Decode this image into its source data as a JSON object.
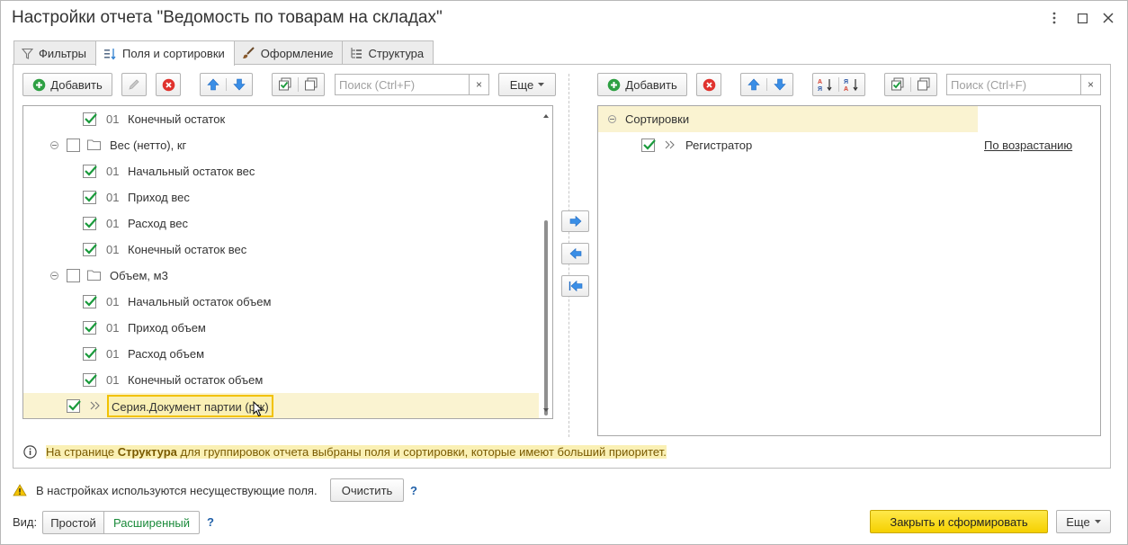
{
  "window": {
    "title": "Настройки отчета \"Ведомость по товарам на складах\"",
    "controls": [
      "more-icon",
      "maximize-icon",
      "close-icon"
    ]
  },
  "tabs": [
    {
      "label": "Фильтры",
      "icon": "filter-icon"
    },
    {
      "label": "Поля и сортировки",
      "icon": "fields-sort-icon",
      "active": true
    },
    {
      "label": "Оформление",
      "icon": "brush-icon"
    },
    {
      "label": "Структура",
      "icon": "structure-icon"
    }
  ],
  "left_toolbar": {
    "add_label": "Добавить",
    "search_placeholder": "Поиск (Ctrl+F)",
    "clear_label": "×",
    "more_label": "Еще"
  },
  "fields_tree": [
    {
      "type": "field",
      "checked": true,
      "num": "01",
      "label": "Конечный остаток"
    },
    {
      "type": "group",
      "checked": false,
      "label": "Вес (нетто), кг"
    },
    {
      "type": "field",
      "checked": true,
      "num": "01",
      "label": "Начальный остаток вес"
    },
    {
      "type": "field",
      "checked": true,
      "num": "01",
      "label": "Приход вес"
    },
    {
      "type": "field",
      "checked": true,
      "num": "01",
      "label": "Расход вес"
    },
    {
      "type": "field",
      "checked": true,
      "num": "01",
      "label": "Конечный остаток вес"
    },
    {
      "type": "group",
      "checked": false,
      "label": "Объем, м3"
    },
    {
      "type": "field",
      "checked": true,
      "num": "01",
      "label": "Начальный остаток объем"
    },
    {
      "type": "field",
      "checked": true,
      "num": "01",
      "label": "Приход объем"
    },
    {
      "type": "field",
      "checked": true,
      "num": "01",
      "label": "Расход объем"
    },
    {
      "type": "field",
      "checked": true,
      "num": "01",
      "label": "Конечный остаток объем"
    },
    {
      "type": "ref",
      "checked": true,
      "label": "Серия.Документ партии (ргк)",
      "selected": true
    }
  ],
  "right_toolbar": {
    "add_label": "Добавить",
    "search_placeholder": "Поиск (Ctrl+F)",
    "clear_label": "×"
  },
  "sort_tree": {
    "root_label": "Сортировки",
    "items": [
      {
        "checked": true,
        "label": "Регистратор",
        "direction": "По возрастанию"
      }
    ]
  },
  "info": {
    "prefix": "На странице ",
    "bold": "Структура",
    "suffix": " для группировок отчета выбраны поля и сортировки, которые имеют больший приоритет."
  },
  "warning": {
    "text": "В настройках используются несуществующие поля.",
    "clear_label": "Очистить",
    "help": "?"
  },
  "view": {
    "label": "Вид:",
    "simple": "Простой",
    "extended": "Расширенный",
    "help": "?"
  },
  "footer": {
    "close_generate_label": "Закрыть и сформировать",
    "more_label": "Еще"
  },
  "colors": {
    "accent_yellow": "#f5d000",
    "selection": "#faf3d1",
    "check_green": "#1a9a3c",
    "arrow_blue": "#3a8ee6"
  }
}
